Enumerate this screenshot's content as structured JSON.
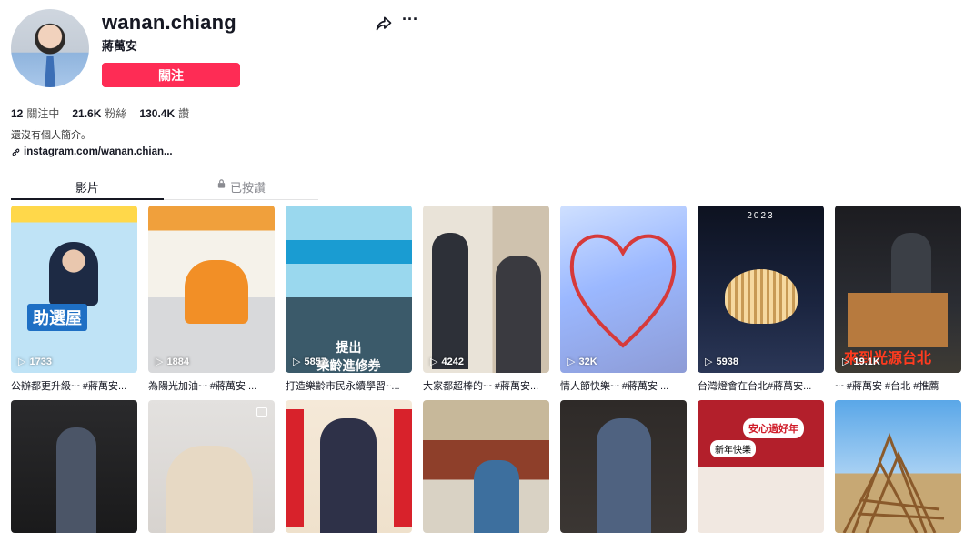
{
  "profile": {
    "username": "wanan.chiang",
    "nickname": "蔣萬安",
    "follow_label": "關注",
    "stats": [
      {
        "value": "12",
        "label": "關注中"
      },
      {
        "value": "21.6K",
        "label": "粉絲"
      },
      {
        "value": "130.4K",
        "label": "讚"
      }
    ],
    "bio": "還沒有個人簡介。",
    "link": "instagram.com/wanan.chian..."
  },
  "tabs": {
    "videos": "影片",
    "liked": "已按讚"
  },
  "videos": [
    {
      "views": "1733",
      "caption": "公辦都更升級~~#蔣萬安..."
    },
    {
      "views": "1884",
      "caption": "為陽光加油~~#蔣萬安 ..."
    },
    {
      "views": "5857",
      "caption": "打造樂齡市民永續學習~..."
    },
    {
      "views": "4242",
      "caption": "大家都超棒的~~#蔣萬安..."
    },
    {
      "views": "32K",
      "caption": "情人節快樂~~#蔣萬安 ..."
    },
    {
      "views": "5938",
      "caption": "台灣燈會在台北#蔣萬安..."
    },
    {
      "views": "19.1K",
      "caption": "~~#蔣萬安 #台北 #推薦"
    }
  ],
  "thumb_text": {
    "t1": "助選屋",
    "t3": "提出\n樂齡進修券",
    "t6": "2023",
    "t7": "來到光源台北",
    "t13a": "安心過好年",
    "t13b": "新年快樂"
  },
  "colors": {
    "accent": "#fe2c55",
    "text": "#161823"
  }
}
